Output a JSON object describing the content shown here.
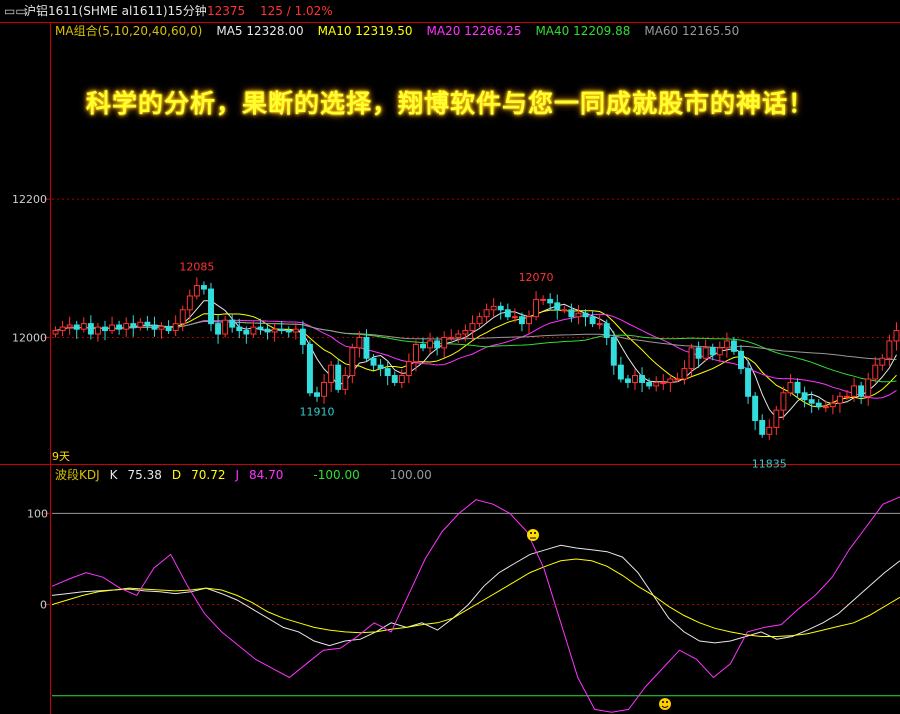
{
  "header": {
    "icon": "window-icon",
    "title": "沪铝1611(SHME al1611)15分钟",
    "price": "12375",
    "change": "125 / 1.02%"
  },
  "ma_legend": [
    {
      "label": "MA组合(5,10,20,40,60,0)",
      "color": "#d8c000"
    },
    {
      "label": "MA5 12328.00",
      "color": "#e8e8e8"
    },
    {
      "label": "MA10 12319.50",
      "color": "#ffff00"
    },
    {
      "label": "MA20 12266.25",
      "color": "#ff33ff"
    },
    {
      "label": "MA40 12209.88",
      "color": "#33dd33"
    },
    {
      "label": "MA60 12165.50",
      "color": "#999999"
    }
  ],
  "slogan": "科学的分析，果断的选择，翔博软件与您一同成就股市的神话！",
  "period_label": "9天",
  "kdj_legend": [
    {
      "label": "波段KDJ",
      "color": "#d8c000"
    },
    {
      "label": "K",
      "color": "#e8e8e8"
    },
    {
      "label": "75.38",
      "color": "#e8e8e8"
    },
    {
      "label": "D",
      "color": "#ffff00"
    },
    {
      "label": "70.72",
      "color": "#ffff00"
    },
    {
      "label": "J",
      "color": "#ff33ff"
    },
    {
      "label": "84.70",
      "color": "#ff33ff"
    },
    {
      "label": "-100.00",
      "color": "#33dd33"
    },
    {
      "label": "100.00",
      "color": "#999999"
    }
  ],
  "chart_data": [
    {
      "type": "candlestick",
      "y_ticks": [
        12000,
        12200
      ],
      "ylim": [
        11820,
        12430
      ],
      "annotations": [
        {
          "label": "12085",
          "value": 12085,
          "color": "#ff3333"
        },
        {
          "label": "12070",
          "value": 12070,
          "color": "#ff3333"
        },
        {
          "label": "11910",
          "value": 11910,
          "color": "#33cccc"
        },
        {
          "label": "11835",
          "value": 11835,
          "color": "#33cccc"
        }
      ],
      "colors": {
        "up": "#ff3333",
        "down": "#33dddd",
        "grid": "#aa0000"
      },
      "close": [
        12010,
        12015,
        12018,
        12012,
        12020,
        12005,
        12015,
        12010,
        12018,
        12012,
        12020,
        12015,
        12022,
        12018,
        12012,
        12016,
        12010,
        12020,
        12040,
        12060,
        12075,
        12070,
        12020,
        12005,
        12025,
        12015,
        12010,
        12005,
        12015,
        12012,
        12008,
        12012,
        12010,
        12008,
        12012,
        11990,
        11920,
        11915,
        11935,
        11960,
        11925,
        11945,
        11985,
        12000,
        11970,
        11960,
        11955,
        11945,
        11935,
        11945,
        11965,
        11990,
        11985,
        11995,
        11985,
        12000,
        12000,
        12005,
        12010,
        12020,
        12030,
        12040,
        12045,
        12040,
        12030,
        12030,
        12020,
        12030,
        12055,
        12055,
        12050,
        12040,
        12040,
        12030,
        12035,
        12030,
        12020,
        12020,
        12000,
        11960,
        11940,
        11935,
        11945,
        11935,
        11930,
        11935,
        11935,
        11940,
        11940,
        11955,
        11985,
        11970,
        11985,
        11975,
        11985,
        11995,
        11980,
        11955,
        11915,
        11880,
        11860,
        11870,
        11895,
        11920,
        11935,
        11920,
        11910,
        11905,
        11900,
        11900,
        11905,
        11915,
        11915,
        11930,
        11915,
        11940,
        11960,
        11970,
        11995,
        12010
      ],
      "open": [
        12005,
        12010,
        12015,
        12018,
        12012,
        12020,
        12005,
        12015,
        12010,
        12018,
        12012,
        12020,
        12015,
        12022,
        12018,
        12012,
        12016,
        12010,
        12020,
        12040,
        12060,
        12075,
        12070,
        12020,
        12005,
        12025,
        12015,
        12010,
        12005,
        12015,
        12012,
        12008,
        12012,
        12010,
        12008,
        12012,
        11990,
        11920,
        11915,
        11935,
        11960,
        11925,
        11945,
        11985,
        12000,
        11970,
        11960,
        11955,
        11945,
        11935,
        11945,
        11965,
        11990,
        11985,
        11995,
        11985,
        12000,
        12000,
        12005,
        12010,
        12020,
        12030,
        12040,
        12045,
        12040,
        12030,
        12030,
        12020,
        12030,
        12055,
        12055,
        12050,
        12040,
        12040,
        12030,
        12035,
        12030,
        12020,
        12020,
        12000,
        11960,
        11940,
        11935,
        11945,
        11935,
        11930,
        11935,
        11935,
        11940,
        11940,
        11955,
        11985,
        11970,
        11985,
        11975,
        11985,
        11995,
        11980,
        11955,
        11915,
        11880,
        11860,
        11870,
        11895,
        11920,
        11935,
        11920,
        11910,
        11905,
        11900,
        11900,
        11905,
        11915,
        11915,
        11930,
        11915,
        11940,
        11960,
        11970,
        11995
      ]
    },
    {
      "type": "line",
      "title": "波段KDJ",
      "y_ticks": [
        0,
        100
      ],
      "ylim": [
        -120,
        130
      ],
      "reference_lines": [
        100,
        -100
      ],
      "series": [
        {
          "name": "K",
          "color": "#e8e8e8",
          "values": [
            10,
            12,
            14,
            15,
            16,
            17,
            15,
            14,
            12,
            14,
            18,
            12,
            5,
            -5,
            -15,
            -25,
            -30,
            -40,
            -45,
            -40,
            -38,
            -30,
            -20,
            -25,
            -20,
            -28,
            -15,
            0,
            20,
            35,
            45,
            55,
            60,
            65,
            62,
            60,
            58,
            52,
            35,
            10,
            -15,
            -30,
            -40,
            -42,
            -40,
            -35,
            -30,
            -38,
            -35,
            -28,
            -20,
            -10,
            5,
            20,
            35,
            48
          ]
        },
        {
          "name": "D",
          "color": "#ffff00",
          "values": [
            0,
            5,
            10,
            14,
            16,
            18,
            17,
            16,
            15,
            16,
            18,
            16,
            10,
            2,
            -8,
            -15,
            -20,
            -25,
            -28,
            -30,
            -31,
            -30,
            -27,
            -25,
            -22,
            -20,
            -15,
            -5,
            5,
            15,
            25,
            35,
            42,
            48,
            50,
            48,
            42,
            32,
            20,
            10,
            -2,
            -12,
            -20,
            -26,
            -30,
            -33,
            -35,
            -35,
            -34,
            -32,
            -28,
            -24,
            -20,
            -12,
            -2,
            8
          ]
        },
        {
          "name": "J",
          "color": "#ff33ff",
          "values": [
            20,
            28,
            35,
            30,
            18,
            10,
            40,
            55,
            20,
            -10,
            -30,
            -45,
            -60,
            -70,
            -80,
            -65,
            -50,
            -48,
            -35,
            -20,
            -30,
            10,
            50,
            80,
            100,
            115,
            110,
            100,
            80,
            40,
            -20,
            -80,
            -115,
            -118,
            -115,
            -90,
            -70,
            -50,
            -60,
            -80,
            -65,
            -30,
            -25,
            -22,
            -5,
            10,
            30,
            60,
            85,
            110,
            118
          ]
        }
      ]
    }
  ]
}
